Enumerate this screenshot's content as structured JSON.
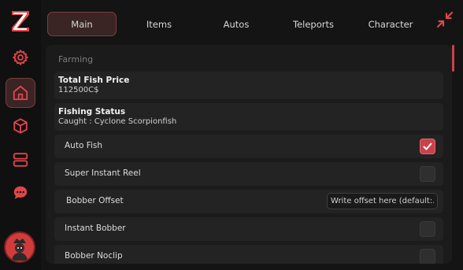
{
  "brand": {
    "logo_letter": "Z",
    "accent": "#e0454b"
  },
  "sidebar": {
    "items": [
      {
        "name": "settings",
        "icon": "gear-icon"
      },
      {
        "name": "home",
        "icon": "home-icon",
        "active": true
      },
      {
        "name": "packages",
        "icon": "cube-icon"
      },
      {
        "name": "servers",
        "icon": "server-icon"
      },
      {
        "name": "chat",
        "icon": "chat-icon"
      }
    ],
    "avatar_icon": "avatar"
  },
  "tabs": [
    {
      "label": "Main",
      "active": true
    },
    {
      "label": "Items"
    },
    {
      "label": "Autos"
    },
    {
      "label": "Teleports"
    },
    {
      "label": "Character"
    }
  ],
  "section": {
    "label": "Farming"
  },
  "info": {
    "total_price_title": "Total Fish Price",
    "total_price_value": "112500C$",
    "status_title": "Fishing Status",
    "status_value": "Caught : Cyclone Scorpionfish"
  },
  "rows": {
    "auto_fish": {
      "label": "Auto Fish",
      "checked": true
    },
    "super_reel": {
      "label": "Super Instant Reel",
      "checked": false
    },
    "bobber_offset": {
      "label": "Bobber Offset",
      "placeholder": "Write offset here (default:..."
    },
    "instant_bobber": {
      "label": "Instant Bobber",
      "checked": false
    },
    "bobber_noclip": {
      "label": "Bobber Noclip",
      "checked": false
    }
  }
}
